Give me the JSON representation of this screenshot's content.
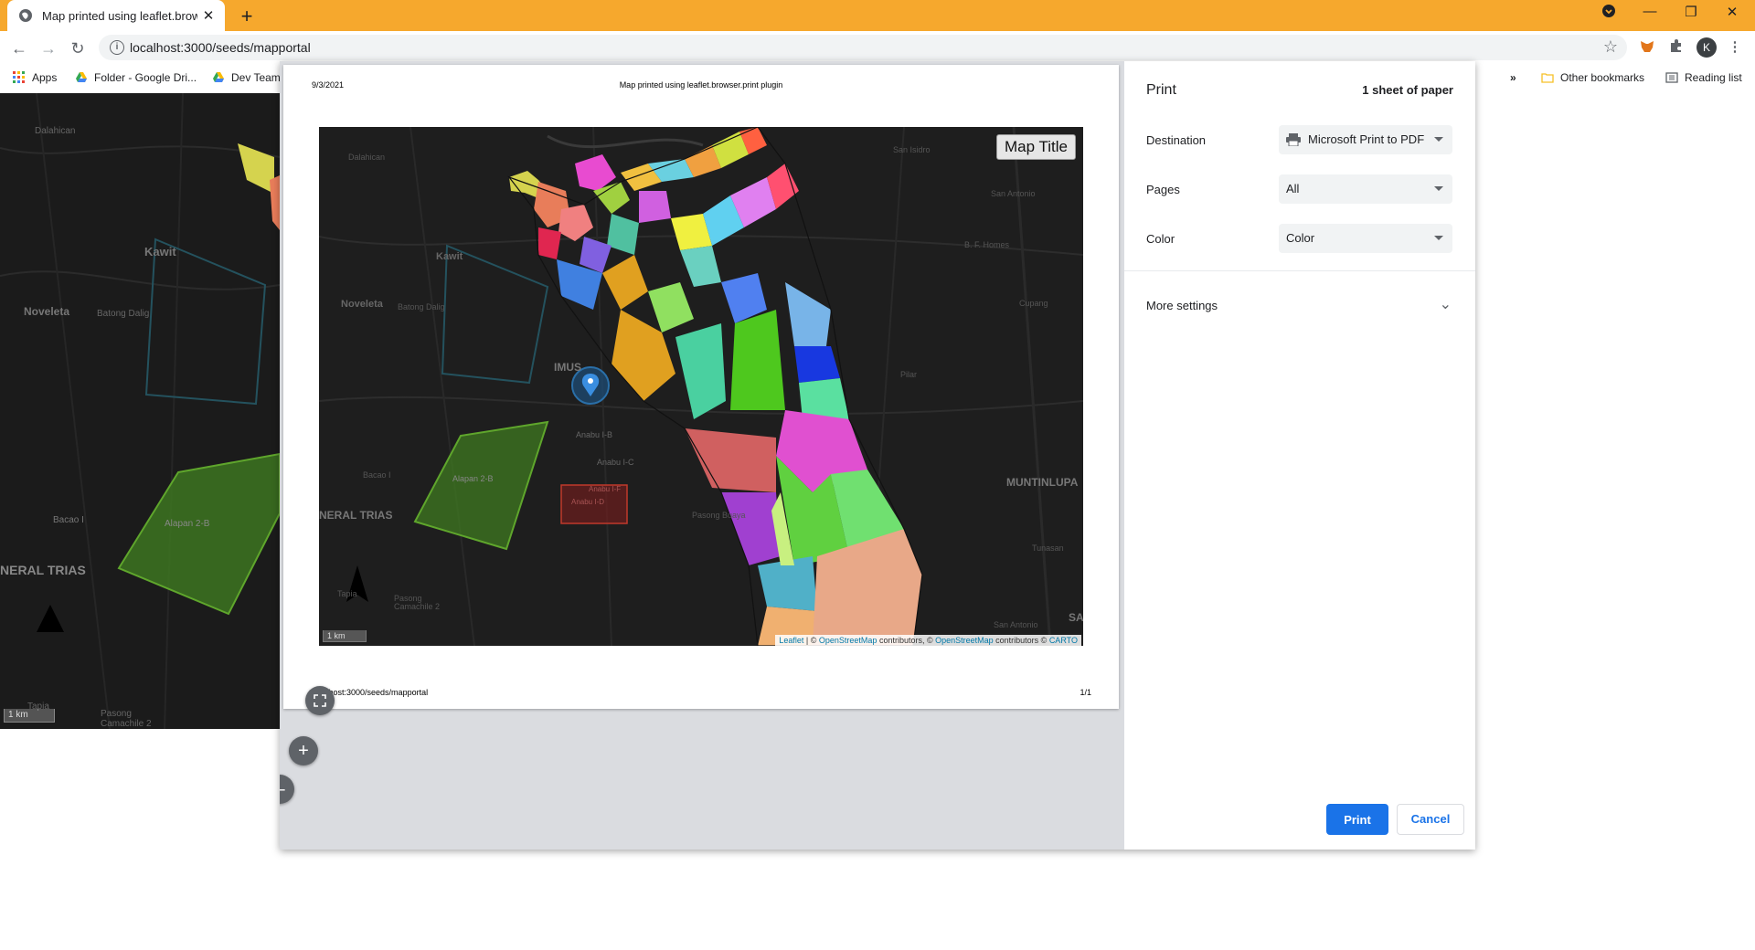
{
  "browser": {
    "tab_title": "Map printed using leaflet.browser.print plugin",
    "url": "localhost:3000/seeds/mapportal",
    "avatar_letter": "K",
    "accent": "#f6a82d"
  },
  "bookmarks": {
    "apps": "Apps",
    "folder": "Folder - Google Dri...",
    "devteam": "Dev Team",
    "more": "»",
    "other": "Other bookmarks",
    "reading": "Reading list"
  },
  "background_map": {
    "labels": [
      "Dalahican",
      "Kawit",
      "Noveleta",
      "Batong Dalig",
      "Alapan 2-B",
      "Bacao I",
      "NERAL TRIAS",
      "Tapia",
      "Pasong Camachile 2"
    ],
    "scale": "1 km"
  },
  "print_preview": {
    "date": "9/3/2021",
    "header_title": "Map printed using leaflet.browser.print plugin",
    "footer_url": "localhost:3000/seeds/mapportal",
    "page_count": "1/1",
    "map_title": "Map Title",
    "scale": "1 km",
    "attribution": {
      "leaflet": "Leaflet",
      "sep1": " | © ",
      "osm1": "OpenStreetMap",
      "mid": " contributors, © ",
      "osm2": "OpenStreetMap",
      "mid2": " contributors © ",
      "carto": "CARTO"
    },
    "place_labels": [
      "Dalahican",
      "San Isidro",
      "San Antonio",
      "Kawit",
      "B. F. Homes",
      "Noveleta",
      "Batong Dalig",
      "Cupang",
      "IMUS",
      "Pilar",
      "Anabu I-B",
      "Anabu I-C",
      "Bacao I",
      "Alapan 2-B",
      "Anabu I-F",
      "Anabu I-D",
      "MUNTINLUPA",
      "NERAL TRIAS",
      "Pasong Buaya",
      "Tunasan",
      "Tapia",
      "Pasong Camachile 2",
      "San Antonio",
      "SA"
    ]
  },
  "print_settings": {
    "title": "Print",
    "sheets": "1 sheet of paper",
    "destination_label": "Destination",
    "destination_value": "Microsoft Print to PDF",
    "pages_label": "Pages",
    "pages_value": "All",
    "color_label": "Color",
    "color_value": "Color",
    "more_settings": "More settings",
    "print_button": "Print",
    "cancel_button": "Cancel",
    "primary_color": "#1a73e8"
  }
}
